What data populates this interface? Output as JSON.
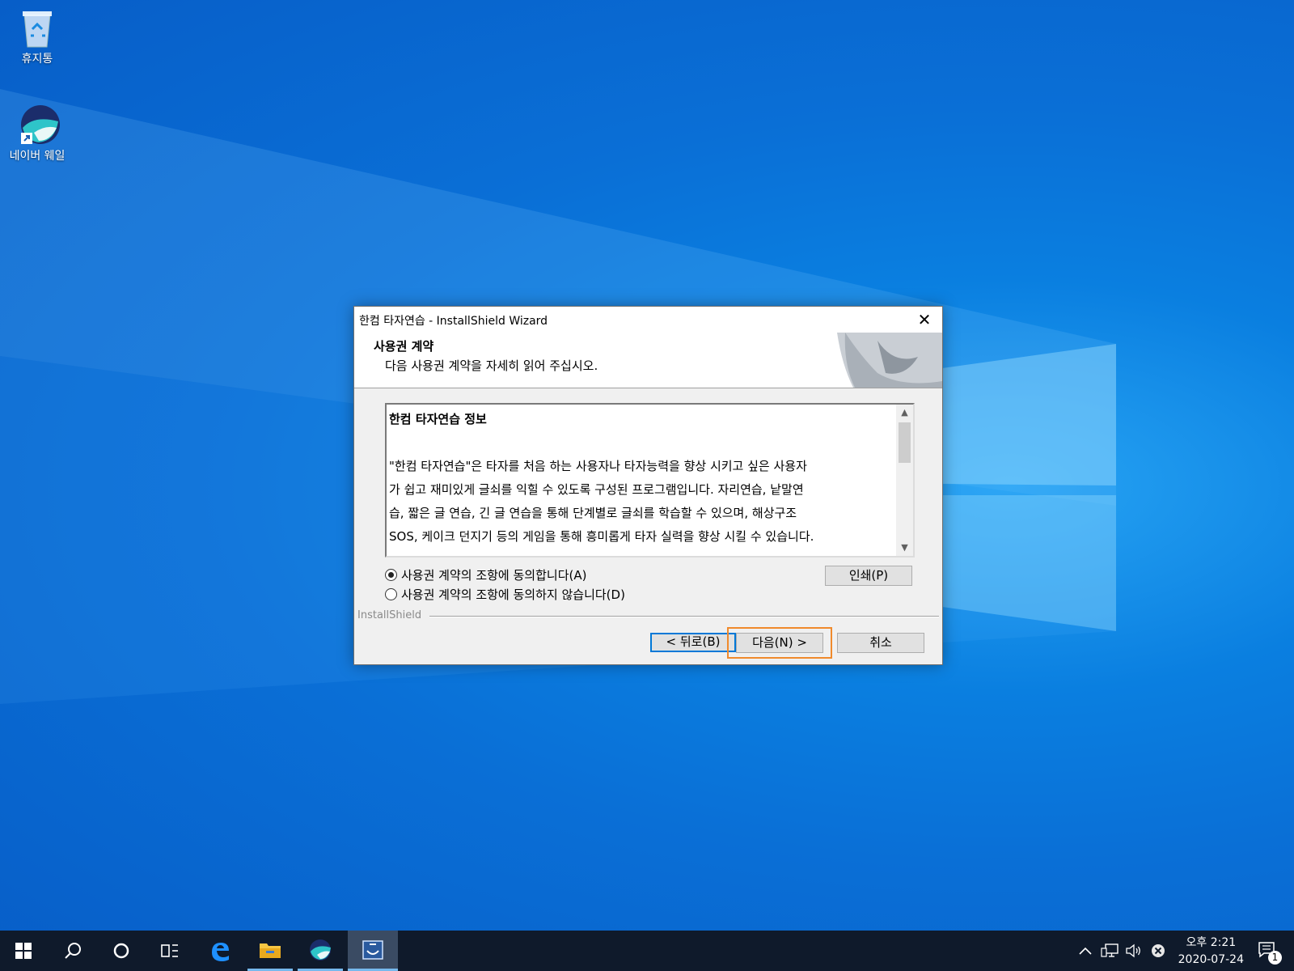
{
  "desktop": {
    "icons": [
      {
        "label": "휴지통",
        "icon": "recycle-bin-icon"
      },
      {
        "label": "네이버 웨일",
        "icon": "whale-browser-icon"
      }
    ]
  },
  "dialog": {
    "title": "한컴 타자연습 - InstallShield Wizard",
    "close_glyph": "✕",
    "header_title": "사용권 계약",
    "header_subtitle": "다음 사용권 계약을 자세히 읽어 주십시오.",
    "license": {
      "title": "한컴 타자연습 정보",
      "lines": [
        "\"한컴 타자연습\"은 타자를 처음 하는 사용자나 타자능력을 향상 시키고 싶은 사용자",
        "가 쉽고 재미있게 글쇠를 익힐 수 있도록 구성된 프로그램입니다. 자리연습, 낱말연",
        "습, 짧은 글 연습, 긴 글 연습을 통해 단계별로 글쇠를 학습할 수 있으며, 해상구조",
        "SOS, 케이크 던지기 등의 게임을 통해 흥미롭게 타자 실력을 향상 시킬 수 있습니다."
      ]
    },
    "radio_accept": "사용권 계약의 조항에 동의합니다(A)",
    "radio_decline": "사용권 계약의 조항에 동의하지 않습니다(D)",
    "selected": "accept",
    "print_button": "인쇄(P)",
    "installshield_label": "InstallShield",
    "back_button": "< 뒤로(B)",
    "next_button": "다음(N) >",
    "cancel_button": "취소",
    "highlight_color": "#f08a2c"
  },
  "taskbar": {
    "items": [
      "start-icon",
      "search-icon",
      "cortana-icon",
      "task-view-icon",
      "edge-icon",
      "file-explorer-icon",
      "whale-browser-icon",
      "installer-icon"
    ],
    "tray": [
      "chevron-up-icon",
      "network-icon",
      "volume-icon",
      "error-icon"
    ],
    "clock_time": "오후 2:21",
    "clock_date": "2020-07-24",
    "notification_count": "1"
  }
}
